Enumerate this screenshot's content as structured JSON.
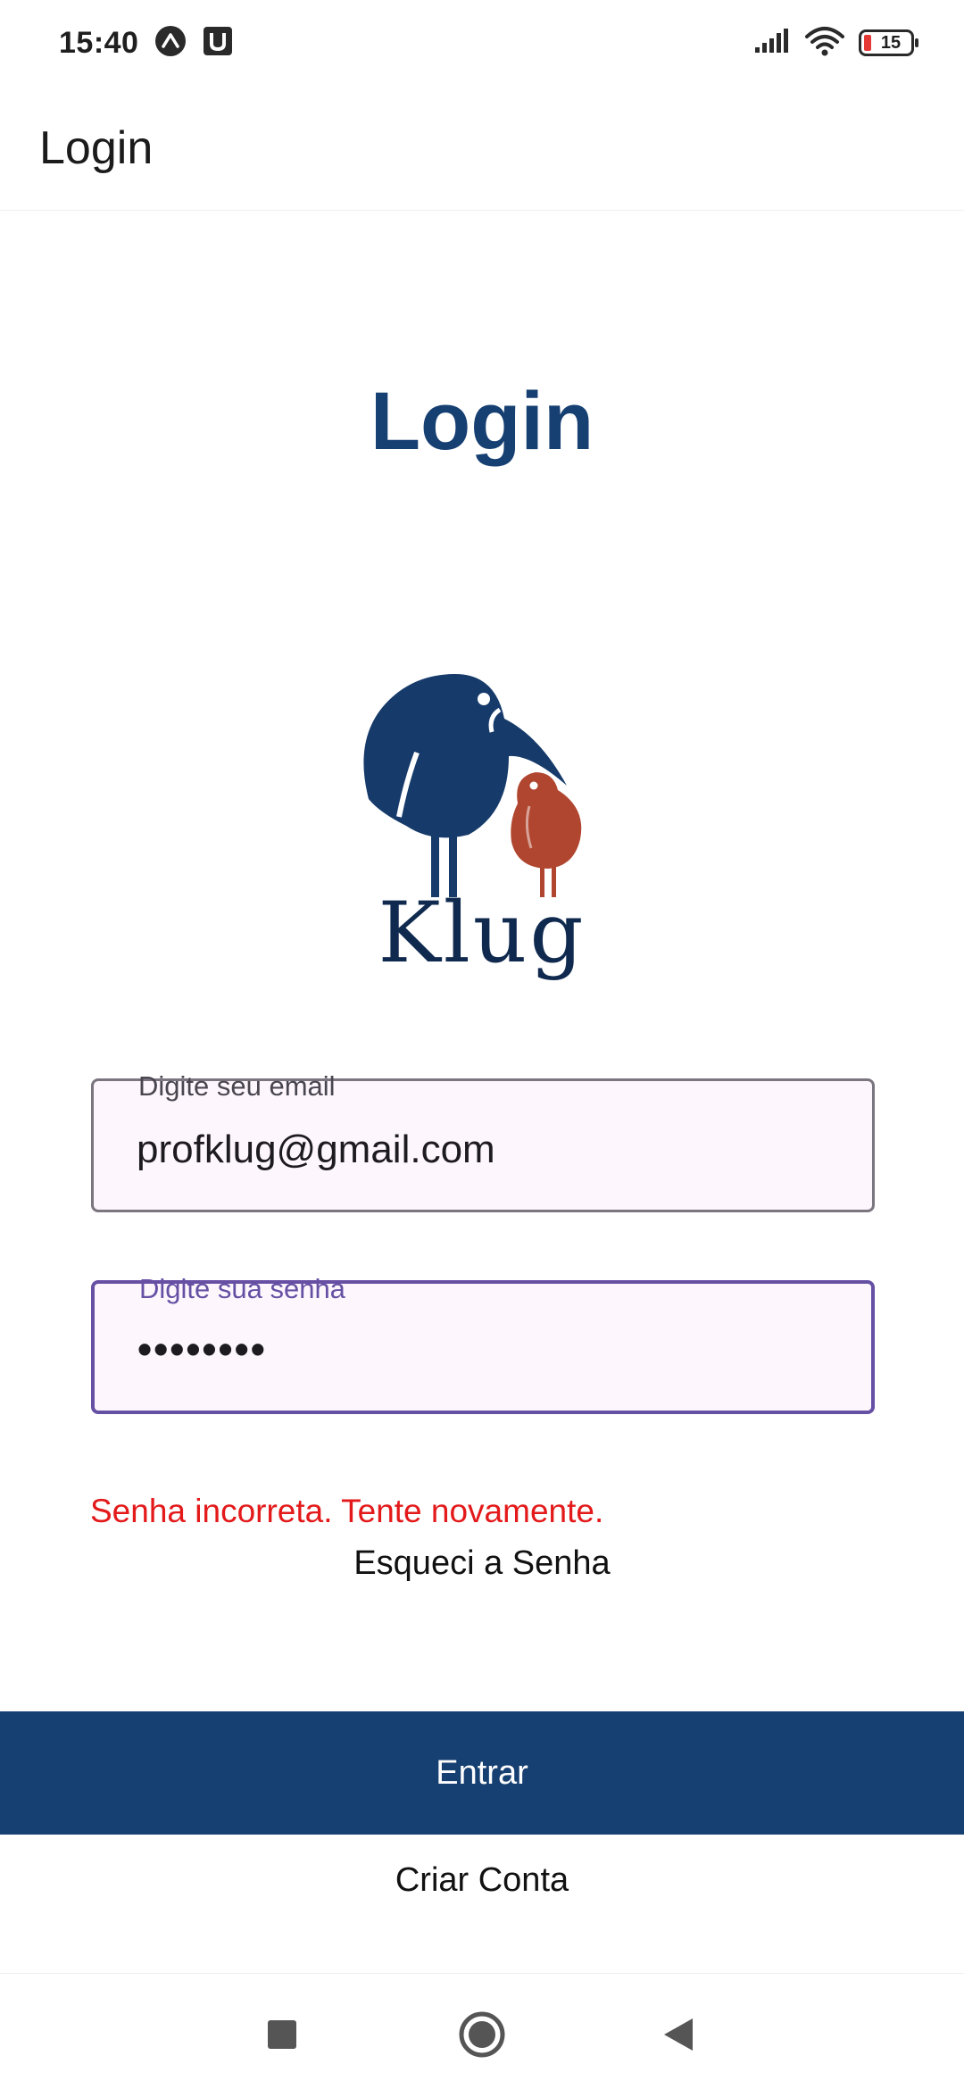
{
  "status_bar": {
    "time": "15:40",
    "notification_icons": [
      "arc-icon",
      "u-icon"
    ],
    "battery": "15",
    "icons": [
      "signal-icon",
      "wifi-icon",
      "battery-icon"
    ]
  },
  "app_bar": {
    "title": "Login"
  },
  "page": {
    "heading": "Login",
    "logo_text": "Klug"
  },
  "form": {
    "email_label": "Digite seu email",
    "email_value": "profklug@gmail.com",
    "password_label": "Digite sua senha",
    "password_value": "••••••••",
    "error": "Senha incorreta. Tente novamente.",
    "forgot_label": "Esqueci a Senha",
    "submit_label": "Entrar",
    "create_label": "Criar Conta"
  },
  "nav_bar": {
    "icons": [
      "square-recents-icon",
      "circle-home-icon",
      "triangle-back-icon"
    ]
  },
  "colors": {
    "primary": "#163f72",
    "accent": "#6650a4",
    "error": "#e3191a",
    "logo_bird_large": "#163a6a",
    "logo_bird_small": "#b04630"
  }
}
